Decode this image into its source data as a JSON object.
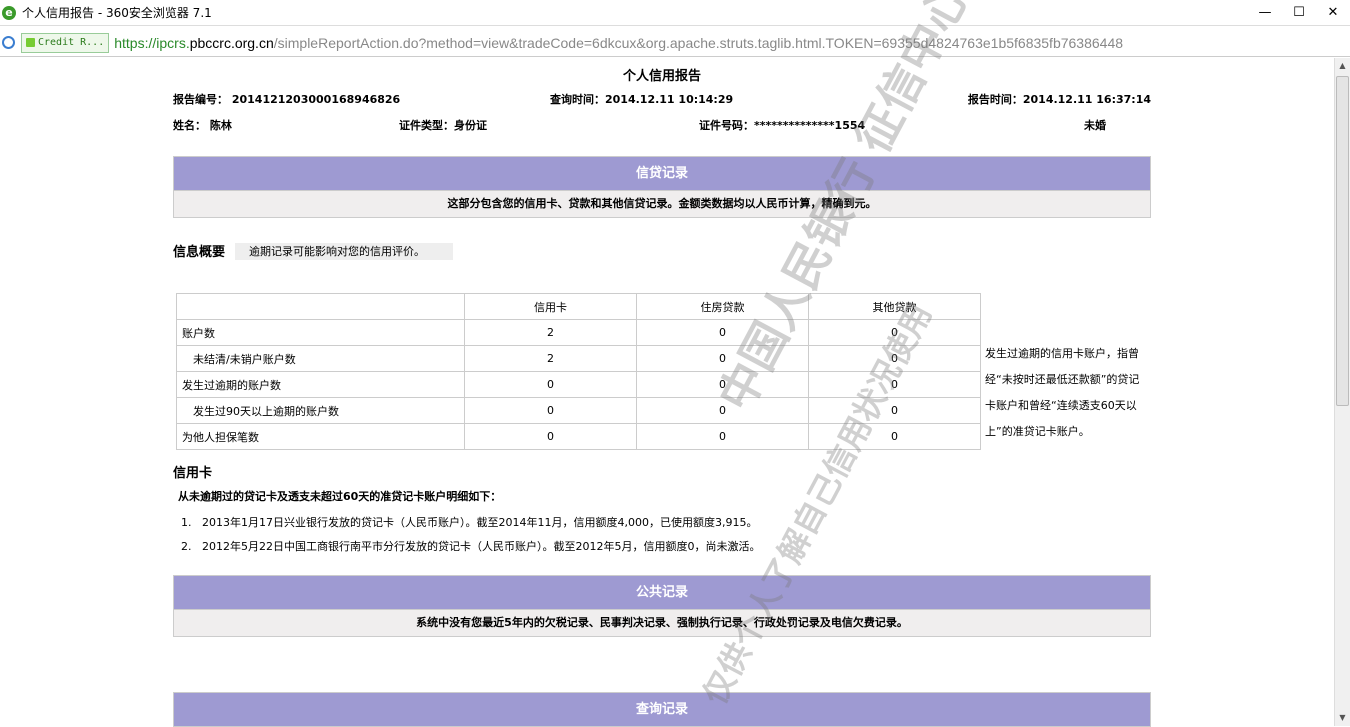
{
  "browser": {
    "title": "个人信用报告 - 360安全浏览器 7.1",
    "security_badge": "Credit R...",
    "url_scheme": "https://ipcrs.",
    "url_domain": "pbccrc.org.cn",
    "url_path": "/simpleReportAction.do?method=view&tradeCode=6dkcux&org.apache.struts.taglib.html.TOKEN=69355d4824763e1b5f6835fb76386448",
    "min": "—",
    "max": "☐",
    "close": "✕"
  },
  "report": {
    "title": "个人信用报告",
    "report_no": "报告编号： 2014121203000168946826",
    "query_time": "查询时间：2014.12.11 10:14:29",
    "report_time": "报告时间：2014.12.11 16:37:14",
    "name": "姓名： 陈林",
    "id_type": "证件类型：身份证",
    "id_no": "证件号码：**************1554",
    "marital": "未婚"
  },
  "credit": {
    "header": "信贷记录",
    "desc": "这部分包含您的信用卡、贷款和其他信贷记录。金额类数据均以人民币计算，精确到元。",
    "overview_title": "信息概要",
    "overview_note": "逾期记录可能影响对您的信用评价。",
    "table": {
      "columns": [
        "",
        "信用卡",
        "住房贷款",
        "其他贷款"
      ],
      "rows": [
        [
          "账户数",
          "2",
          "0",
          "0"
        ],
        [
          "　未结清/未销户账户数",
          "2",
          "0",
          "0"
        ],
        [
          "发生过逾期的账户数",
          "0",
          "0",
          "0"
        ],
        [
          "　发生过90天以上逾期的账户数",
          "0",
          "0",
          "0"
        ],
        [
          "为他人担保笔数",
          "0",
          "0",
          "0"
        ]
      ]
    },
    "side_note": "发生过逾期的信用卡账户，指曾经“未按时还最低还款额”的贷记卡账户和曾经“连续透支60天以上”的准贷记卡账户。",
    "card_title": "信用卡",
    "card_sub": "从未逾期过的贷记卡及透支未超过60天的准贷记卡账户明细如下：",
    "cards": [
      {
        "num": "1.",
        "text": "2013年1月17日兴业银行发放的贷记卡（人民币账户）。截至2014年11月，信用额度4,000，已使用额度3,915。"
      },
      {
        "num": "2.",
        "text": "2012年5月22日中国工商银行南平市分行发放的贷记卡（人民币账户）。截至2012年5月，信用额度0，尚未激活。"
      }
    ]
  },
  "public": {
    "header": "公共记录",
    "desc": "系统中没有您最近5年内的欠税记录、民事判决记录、强制执行记录、行政处罚记录及电信欠费记录。"
  },
  "query": {
    "header": "查询记录"
  },
  "watermark": {
    "line1": "中国人民银行 征信中心",
    "line2": "仅供个人了解自己信用状况使用"
  }
}
